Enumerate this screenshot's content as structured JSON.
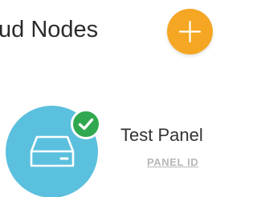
{
  "header": {
    "title": "ud Nodes",
    "add_button_icon": "plus-icon"
  },
  "node": {
    "name": "Test Panel",
    "id_label": "PANEL ID",
    "icon": "server-drive-icon",
    "status_icon": "checkmark-icon"
  },
  "colors": {
    "accent": "#f5a623",
    "node_circle": "#5bc0de",
    "status_ok": "#2fa84f",
    "id_text": "#b7b7b7"
  }
}
